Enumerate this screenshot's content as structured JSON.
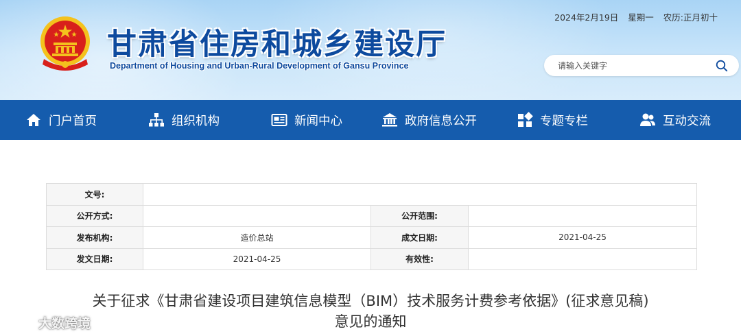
{
  "header": {
    "title": "甘肃省住房和城乡建设厅",
    "subtitle": "Department of Housing and Urban-Rural Development of Gansu Province",
    "date": "2024年2月19日",
    "weekday": "星期一",
    "lunar": "农历:正月初十",
    "search_placeholder": "请输入关键字"
  },
  "nav": {
    "items": [
      {
        "label": "门户首页",
        "icon": "home-icon"
      },
      {
        "label": "组织机构",
        "icon": "org-chart-icon"
      },
      {
        "label": "新闻中心",
        "icon": "newspaper-icon"
      },
      {
        "label": "政府信息公开",
        "icon": "government-building-icon"
      },
      {
        "label": "专题专栏",
        "icon": "grid-icon"
      },
      {
        "label": "互动交流",
        "icon": "users-icon"
      }
    ],
    "bg_color": "#155cad"
  },
  "meta": {
    "doc_no_label": "文号:",
    "doc_no_value": "",
    "public_method_label": "公开方式:",
    "public_method_value": "",
    "public_scope_label": "公开范围:",
    "public_scope_value": "",
    "publisher_label": "发布机构:",
    "publisher_value": "造价总站",
    "written_date_label": "成文日期:",
    "written_date_value": "2021-04-25",
    "issue_date_label": "发文日期:",
    "issue_date_value": "2021-04-25",
    "validity_label": "有效性:",
    "validity_value": ""
  },
  "article": {
    "title_line1": "关于征求《甘肃省建设项目建筑信息模型（BIM）技术服务计费参考依据》(征求意见稿)",
    "title_line2": "意见的通知"
  },
  "watermark": {
    "brand": "大数跨境"
  },
  "colors": {
    "title_blue": "#0d4a9e",
    "emblem_red": "#d8201b",
    "emblem_gold": "#f4c21d"
  }
}
